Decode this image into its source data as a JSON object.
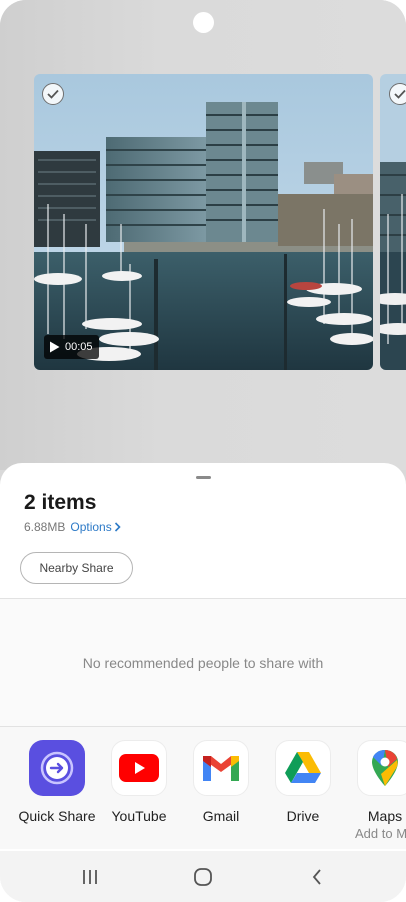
{
  "preview": {
    "video_duration": "00:05"
  },
  "sheet": {
    "title": "2 items",
    "size": "6.88MB",
    "options_label": "Options",
    "nearby_share_label": "Nearby Share",
    "no_people_text": "No recommended people to share with"
  },
  "apps": [
    {
      "label": "Quick Share",
      "icon": "quick-share-icon"
    },
    {
      "label": "YouTube",
      "icon": "youtube-icon"
    },
    {
      "label": "Gmail",
      "icon": "gmail-icon"
    },
    {
      "label": "Drive",
      "icon": "drive-icon"
    },
    {
      "label": "Maps",
      "icon": "maps-icon",
      "sublabel": "Add to M"
    }
  ],
  "navbar": {
    "recents": "recents-icon",
    "home": "home-icon",
    "back": "back-icon"
  },
  "colors": {
    "accent": "#2d7ac7",
    "quick_share": "#5a4fe0",
    "youtube": "#ff0000"
  }
}
